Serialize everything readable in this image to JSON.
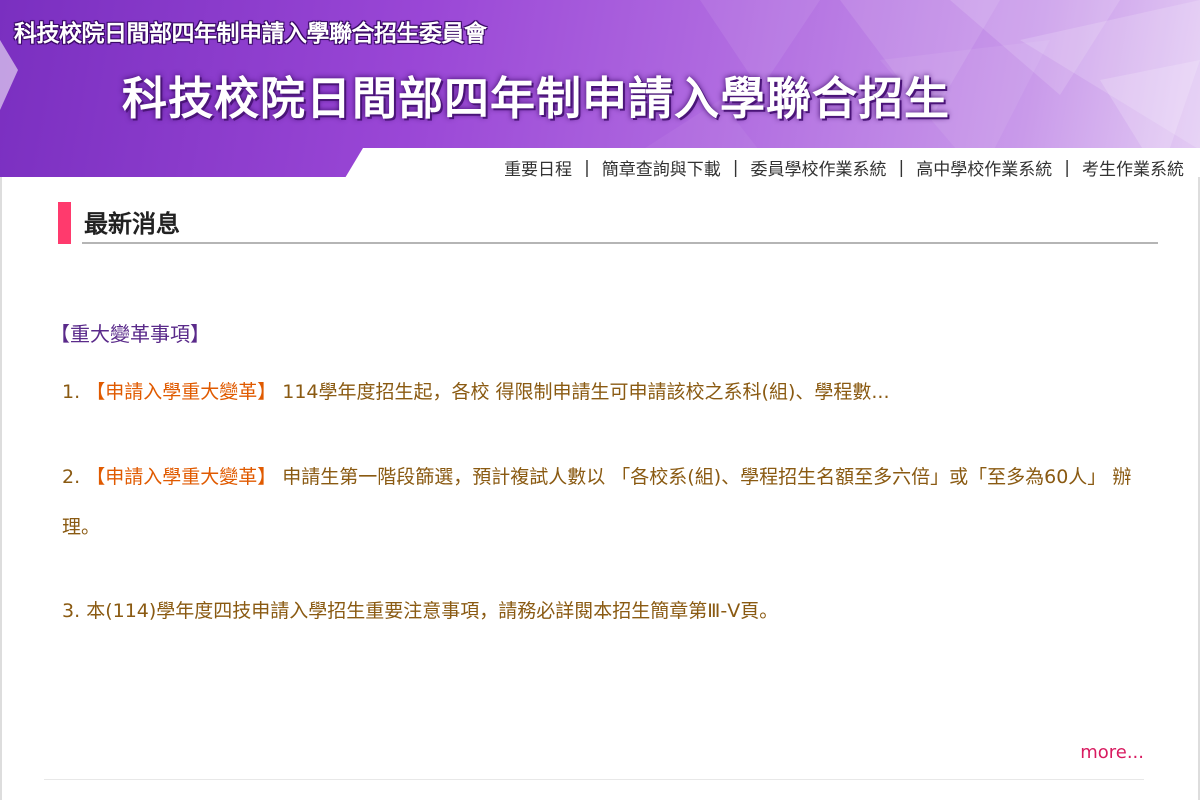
{
  "header": {
    "org_name": "科技校院日間部四年制申請入學聯合招生委員會",
    "title": "科技校院日間部四年制申請入學聯合招生"
  },
  "nav": {
    "items": [
      "重要日程",
      "簡章查詢與下載",
      "委員學校作業系統",
      "高中學校作業系統",
      "考生作業系統"
    ],
    "separator": "|"
  },
  "news": {
    "section_title": "最新消息",
    "category": "【重大變革事項】",
    "items": [
      {
        "num": "1.",
        "tag": "【申請入學重大變革】",
        "text": " 114學年度招生起，各校 得限制申請生可申請該校之系科(組)、學程數..."
      },
      {
        "num": "2.",
        "tag": "【申請入學重大變革】",
        "text": " 申請生第一階段篩選，預計複試人數以 「各校系(組)、學程招生名額至多六倍」或「至多為60人」 辦理。"
      },
      {
        "num": "3.",
        "tag": "",
        "text": "本(114)學年度四技申請入學招生重要注意事項，請務必詳閱本招生簡章第Ⅲ-Ⅴ頁。"
      }
    ],
    "more_label": "more..."
  },
  "colors": {
    "banner_purple": "#9a47d6",
    "section_mark": "#ff3a6d",
    "category_text": "#5a2a8a",
    "news_text": "#8a5a12",
    "tag_text": "#e05a00",
    "more_link": "#d81b60"
  }
}
